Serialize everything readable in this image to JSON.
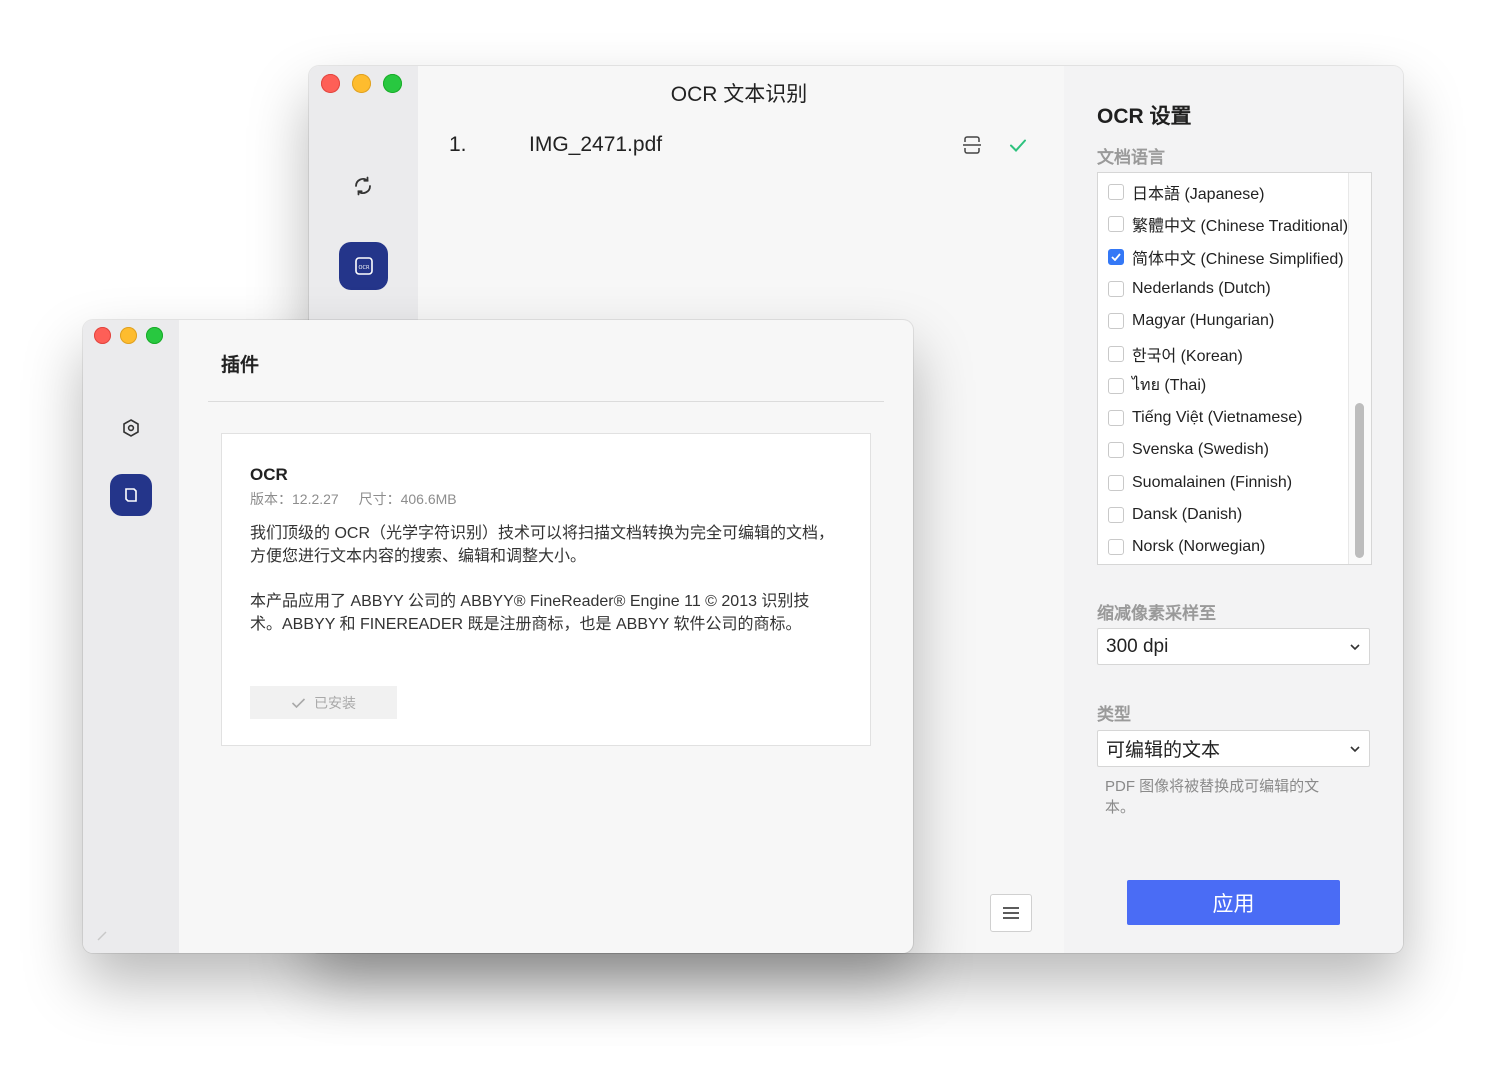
{
  "back_window": {
    "title": "OCR 文本识别",
    "file": {
      "index": "1.",
      "name": "IMG_2471.pdf"
    },
    "settings": {
      "title": "OCR 设置",
      "language_label": "文档语言",
      "languages": [
        {
          "label": "日本語 (Japanese)",
          "checked": false
        },
        {
          "label": "繁體中文 (Chinese Traditional)",
          "checked": false
        },
        {
          "label": "简体中文 (Chinese Simplified)",
          "checked": true
        },
        {
          "label": "Nederlands (Dutch)",
          "checked": false
        },
        {
          "label": "Magyar (Hungarian)",
          "checked": false
        },
        {
          "label": "한국어 (Korean)",
          "checked": false
        },
        {
          "label": "ไทย (Thai)",
          "checked": false
        },
        {
          "label": "Tiếng Việt (Vietnamese)",
          "checked": false
        },
        {
          "label": "Svenska (Swedish)",
          "checked": false
        },
        {
          "label": "Suomalainen (Finnish)",
          "checked": false
        },
        {
          "label": "Dansk (Danish)",
          "checked": false
        },
        {
          "label": "Norsk (Norwegian)",
          "checked": false
        }
      ],
      "downsample_label": "缩减像素采样至",
      "downsample_value": "300 dpi",
      "type_label": "类型",
      "type_value": "可编辑的文本",
      "type_description": "PDF 图像将被替换成可编辑的文本。",
      "apply_label": "应用"
    }
  },
  "front_window": {
    "title": "插件",
    "plugin": {
      "name": "OCR",
      "version": "版本：12.2.27",
      "size": "尺寸：406.6MB",
      "description_1": "我们顶级的 OCR（光学字符识别）技术可以将扫描文档转换为完全可编辑的文档，方便您进行文本内容的搜索、编辑和调整大小。",
      "description_2": "本产品应用了 ABBYY 公司的 ABBYY® FineReader® Engine 11 © 2013 识别技术。ABBYY 和 FINEREADER 既是注册商标，也是 ABBYY 软件公司的商标。",
      "installed_label": "已安装"
    }
  },
  "colors": {
    "accent": "#24358a",
    "apply_button": "#4a6cf5",
    "checkbox": "#3478f6",
    "success_check": "#2ec27e"
  }
}
